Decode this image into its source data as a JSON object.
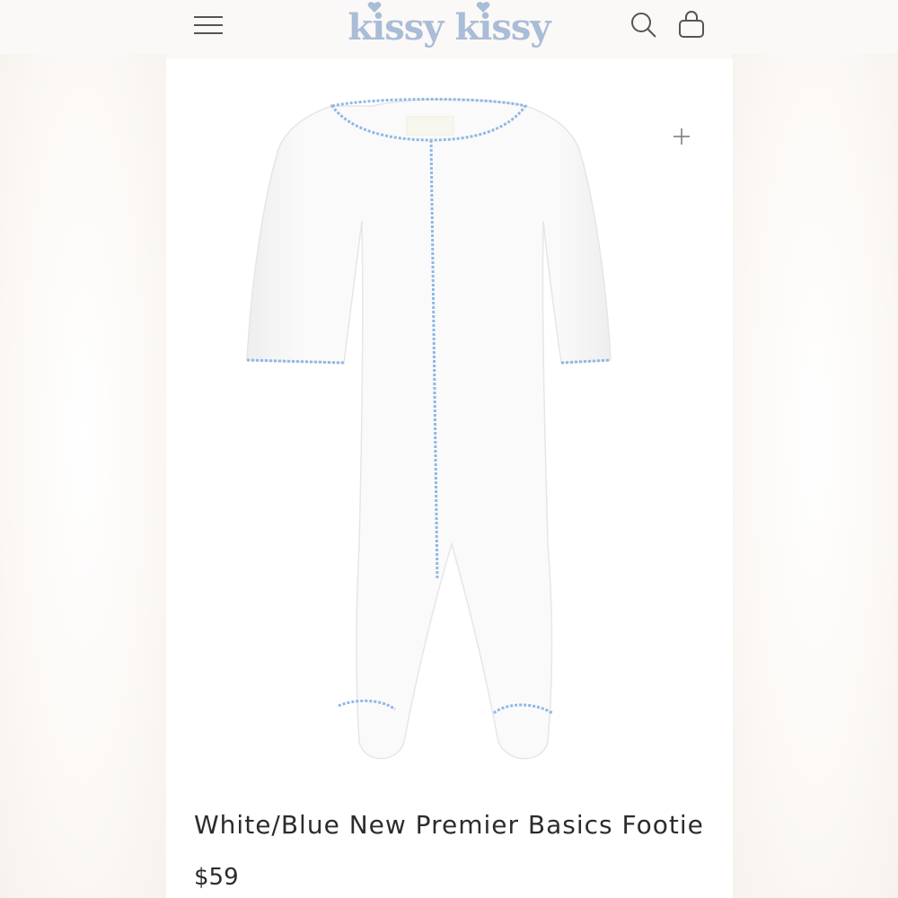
{
  "header": {
    "brand": "kissy kissy",
    "icons": {
      "menu": "hamburger-menu-icon",
      "search": "search-icon",
      "bag": "shopping-bag-icon"
    }
  },
  "product": {
    "title": "White/Blue New Premier Basics Footie",
    "price": "$59",
    "image_alt": "White footie with blue picot trim",
    "zoom_icon": "plus-icon"
  },
  "colors": {
    "brand_blue": "#a9bcd8",
    "trim_blue": "#8fb8e6",
    "text": "#2c2c2c",
    "background": "#fbf9f7"
  }
}
